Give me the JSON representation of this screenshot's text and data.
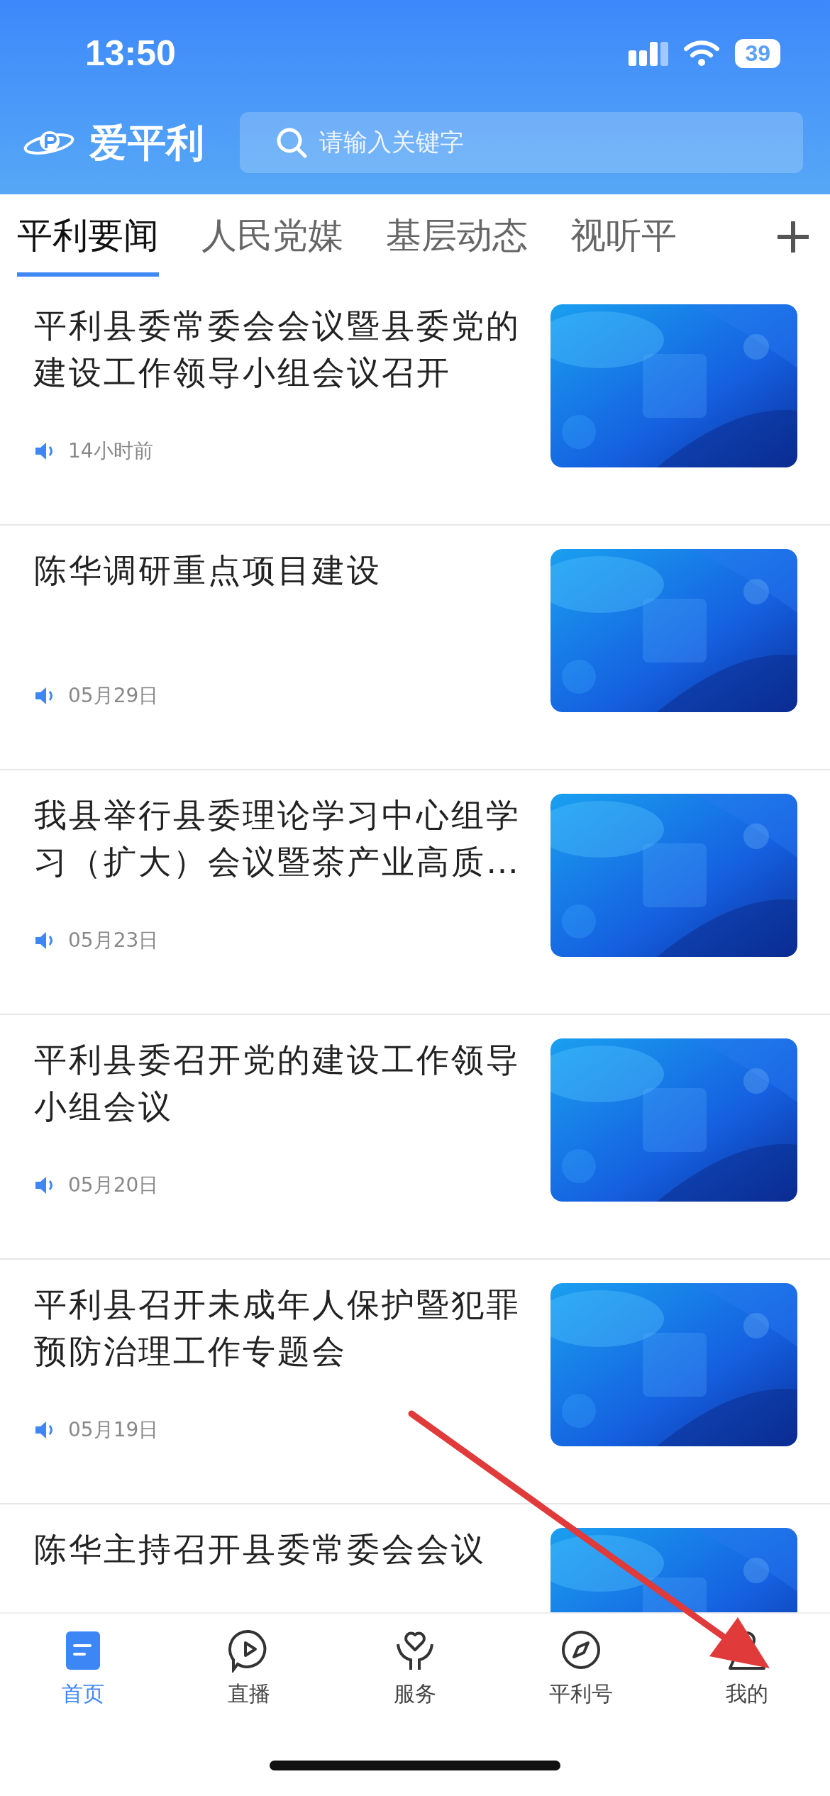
{
  "status_bar": {
    "time": "13:50",
    "battery": "39"
  },
  "header": {
    "logo": "爱平利",
    "search": {
      "placeholder": "请输入关键字"
    }
  },
  "tabs": [
    {
      "label": "平利要闻",
      "selected": true
    },
    {
      "label": "人民党媒",
      "selected": false
    },
    {
      "label": "基层动态",
      "selected": false
    },
    {
      "label": "视听平",
      "selected": false
    }
  ],
  "articles": [
    {
      "title": "平利县委常委会会议暨县委党的建设工作领导小组会议召开",
      "time": "14小时前"
    },
    {
      "title": "陈华调研重点项目建设",
      "time": "05月29日"
    },
    {
      "title": "我县举行县委理论学习中心组学习（扩大）会议暨茶产业高质…",
      "time": "05月23日"
    },
    {
      "title": "平利县委召开党的建设工作领导小组会议",
      "time": "05月20日"
    },
    {
      "title": "平利县召开未成年人保护暨犯罪预防治理工作专题会",
      "time": "05月19日"
    },
    {
      "title": "陈华主持召开县委常委会会议"
    }
  ],
  "bottom_nav": [
    {
      "label": "首页",
      "selected": true
    },
    {
      "label": "直播",
      "selected": false
    },
    {
      "label": "服务",
      "selected": false
    },
    {
      "label": "平利号",
      "selected": false
    },
    {
      "label": "我的",
      "selected": false
    }
  ]
}
